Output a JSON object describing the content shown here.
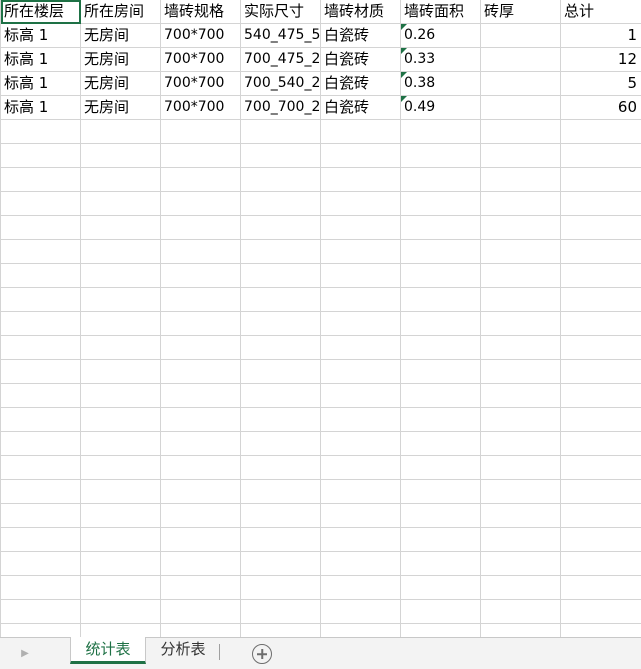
{
  "sheet": {
    "headers": [
      "所在楼层",
      "所在房间",
      "墙砖规格",
      "实际尺寸",
      "墙砖材质",
      "墙砖面积",
      "砖厚",
      "总计"
    ],
    "rows": [
      [
        "标高 1",
        "无房间",
        "700*700",
        "540_475_5",
        "白瓷砖",
        "0.26",
        "",
        "1"
      ],
      [
        "标高 1",
        "无房间",
        "700*700",
        "700_475_2",
        "白瓷砖",
        "0.33",
        "",
        "12"
      ],
      [
        "标高 1",
        "无房间",
        "700*700",
        "700_540_2",
        "白瓷砖",
        "0.38",
        "",
        "5"
      ],
      [
        "标高 1",
        "无房间",
        "700*700",
        "700_700_2",
        "白瓷砖",
        "0.49",
        "",
        "60"
      ]
    ]
  },
  "tabs": {
    "active": "统计表",
    "inactive": "分析表",
    "nav_icon": "triangle-right-icon",
    "add_icon": "plus-circle-icon"
  },
  "colors": {
    "accent": "#1e7145",
    "gridline": "#d4d4d4"
  }
}
